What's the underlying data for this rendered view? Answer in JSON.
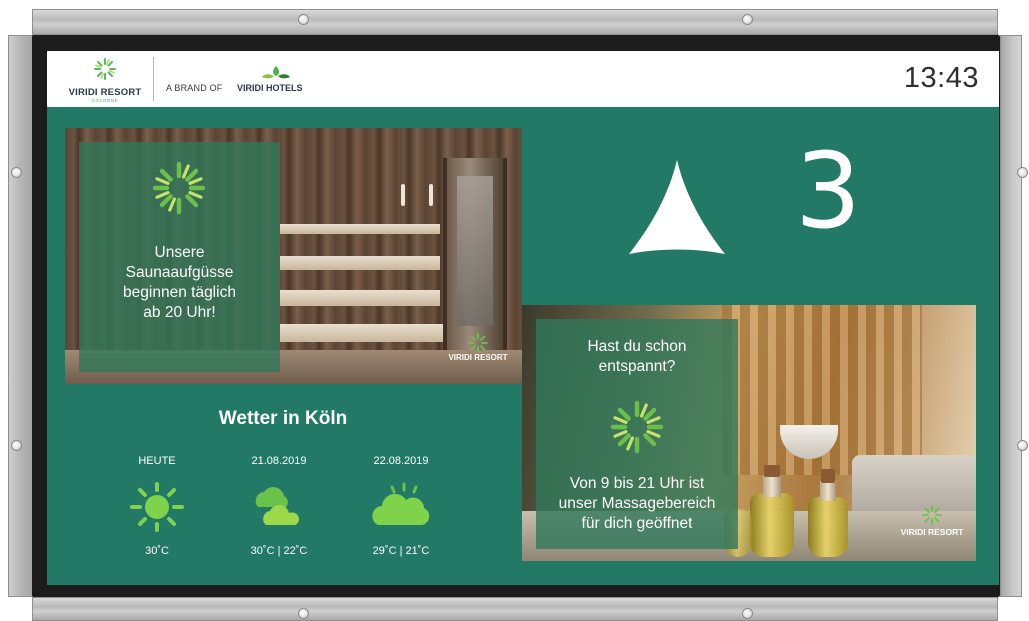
{
  "header": {
    "resort_name": "VIRIDI RESORT",
    "resort_sub": "COLOGNE",
    "brand_of_label": "A BRAND OF",
    "parent_brand": "VIRIDI HOTELS",
    "clock": "13:43"
  },
  "sauna_panel": {
    "message": "Unsere\nSaunaaufgüsse\nbeginnen täglich\nab 20 Uhr!",
    "watermark": "VIRIDI RESORT"
  },
  "direction": {
    "arrow": "up-arrow-icon",
    "floor": "3"
  },
  "weather": {
    "title": "Wetter in Köln",
    "days": [
      {
        "date": "HEUTE",
        "icon": "sun-icon",
        "temp": "30˚C"
      },
      {
        "date": "21.08.2019",
        "icon": "cloud-icon",
        "temp": "30˚C | 22˚C"
      },
      {
        "date": "22.08.2019",
        "icon": "sun-behind-cloud-icon",
        "temp": "29˚C | 21˚C"
      }
    ]
  },
  "massage_panel": {
    "question": "Hast du schon\nentspannt?",
    "answer": "Von 9 bis 21 Uhr ist\nunser Massagebereich\nfür dich geöffnet",
    "watermark": "VIRIDI RESORT"
  },
  "colors": {
    "screen_bg": "#227a66",
    "overlay_green": "#30785a",
    "logo_green": "#4caf50"
  }
}
